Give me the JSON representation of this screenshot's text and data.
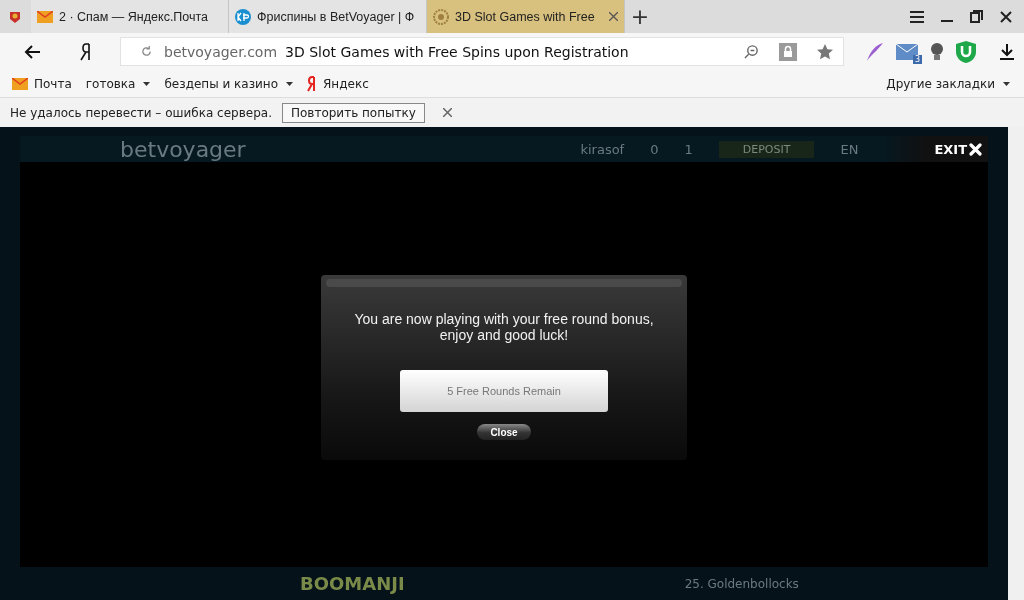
{
  "tabs": [
    {
      "title": "2 · Спам — Яндекс.Почта",
      "selected": false
    },
    {
      "title": "Фриспины в BetVoyager | Ф",
      "selected": false
    },
    {
      "title": "3D Slot Games with Free",
      "selected": true
    }
  ],
  "new_tab": "+",
  "address": {
    "host": "betvoyager.com",
    "title": "3D Slot Games with Free Spins upon Registration"
  },
  "bookmarks": [
    {
      "label": "Почта",
      "dropdown": false
    },
    {
      "label": "готовка",
      "dropdown": true
    },
    {
      "label": "бездепы и казино",
      "dropdown": true
    },
    {
      "label": "Яндекс",
      "dropdown": false
    }
  ],
  "other_bookmarks": "Другие закладки",
  "extension_badge": "3",
  "translate_bar": {
    "message": "Не удалось перевести – ошибка сервера.",
    "retry": "Повторить попытку"
  },
  "site": {
    "logo": "betvoyager",
    "user": "kirasof",
    "coins": "0",
    "messages": "1",
    "deposit": "DEPOSIT",
    "language": "EN",
    "game_title": "25. Goldenbollocks",
    "banner": "BOOMANJI"
  },
  "game": {
    "exit": "EXIT",
    "dialog": {
      "message": "You are now playing with your free round bonus, enjoy and good luck!",
      "rounds": "5 Free Rounds Remain",
      "close": "Close"
    }
  }
}
